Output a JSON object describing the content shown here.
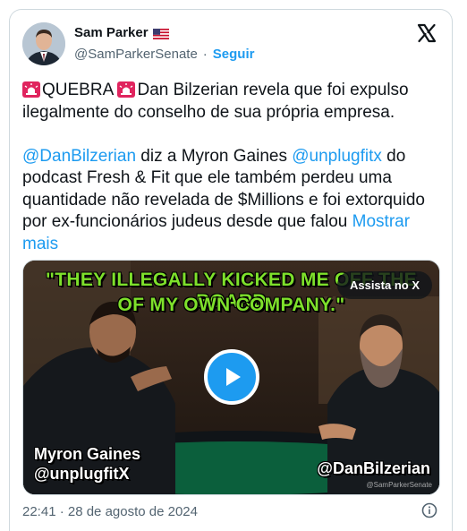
{
  "author": {
    "name": "Sam Parker",
    "handle": "@SamParkerSenate",
    "separator": "·",
    "follow_label": "Seguir"
  },
  "icons": {
    "flag": "us-flag-icon",
    "platform_logo": "x-logo-icon",
    "siren": "siren-emoji-icon",
    "play": "play-icon",
    "info": "info-icon"
  },
  "tweet": {
    "part1": "QUEBRA ",
    "part2": "Dan Bilzerian revela que foi expulso ilegalmente do conselho de sua própria empresa.",
    "mention1": "@DanBilzerian",
    "part3": " diz a Myron Gaines ",
    "mention2": "@unplugfitx",
    "part4": " do podcast Fresh & Fit que ele também perdeu uma quantidade não revelada de $Millions e foi extorquido por ex-funcionários judeus desde que falou ",
    "show_more": "Mostrar mais"
  },
  "media": {
    "caption_line1": "\"THEY ILLEGALLY KICKED ME OFF THE BOARD",
    "caption_line2": "OF MY OWN COMPANY.\"",
    "watch_button": "Assista no X",
    "left_name": "Myron Gaines",
    "left_handle": "@unplugfitX",
    "right_handle": "@DanBilzerian",
    "watermark": "@SamParkerSenate"
  },
  "footer": {
    "timestamp": "22:41 · 28 de agosto de 2024"
  },
  "colors": {
    "accent": "#1d9bf0",
    "text": "#0f1419",
    "secondary": "#536471",
    "caption_green": "#7ee02b",
    "border": "#cfd9de"
  }
}
